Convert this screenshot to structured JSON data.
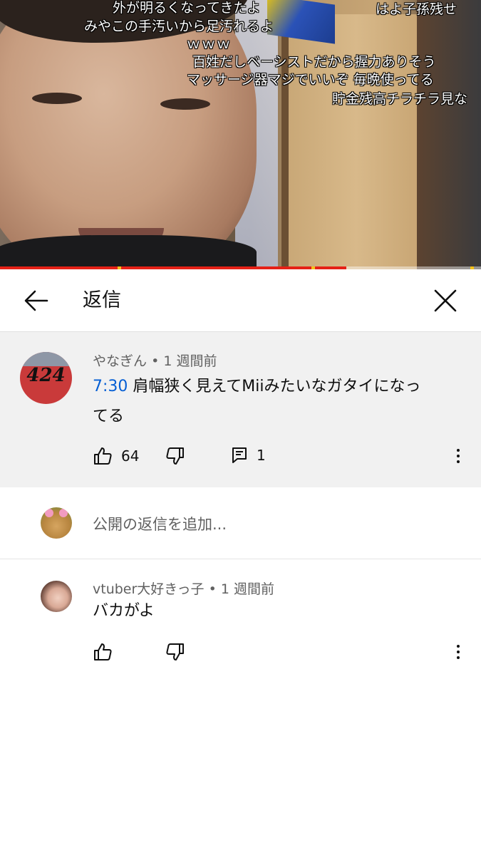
{
  "video": {
    "danmaku": [
      "外が明るくなってきたよ",
      "はよ子孫残せ",
      "みやこの手汚いから足汚れるよ",
      "ｗｗｗ",
      "百姓だしベーシストだから握力ありそう",
      "マッサージ器マジでいいぞ 毎晩使ってる",
      "貯金残高チラチラ見な"
    ],
    "progress_played_fraction": 0.72
  },
  "header": {
    "title": "返信"
  },
  "parent_comment": {
    "author": "やなぎん",
    "separator": "•",
    "time_ago": "1 週間前",
    "avatar_text": "424",
    "timestamp_link": "7:30",
    "text_line1": " 肩幅狭く見えてMiiみたいなガタイになっ",
    "text_line2": "てる",
    "likes": "64",
    "reply_count": "1"
  },
  "add_reply": {
    "placeholder": "公開の返信を追加..."
  },
  "replies": [
    {
      "author": "vtuber大好きっ子",
      "separator": "•",
      "time_ago": "1 週間前",
      "text": "バカがよ"
    }
  ],
  "colors": {
    "link": "#065fd4",
    "progress": "#e52117",
    "highlight_bg": "#f1f1f1"
  }
}
